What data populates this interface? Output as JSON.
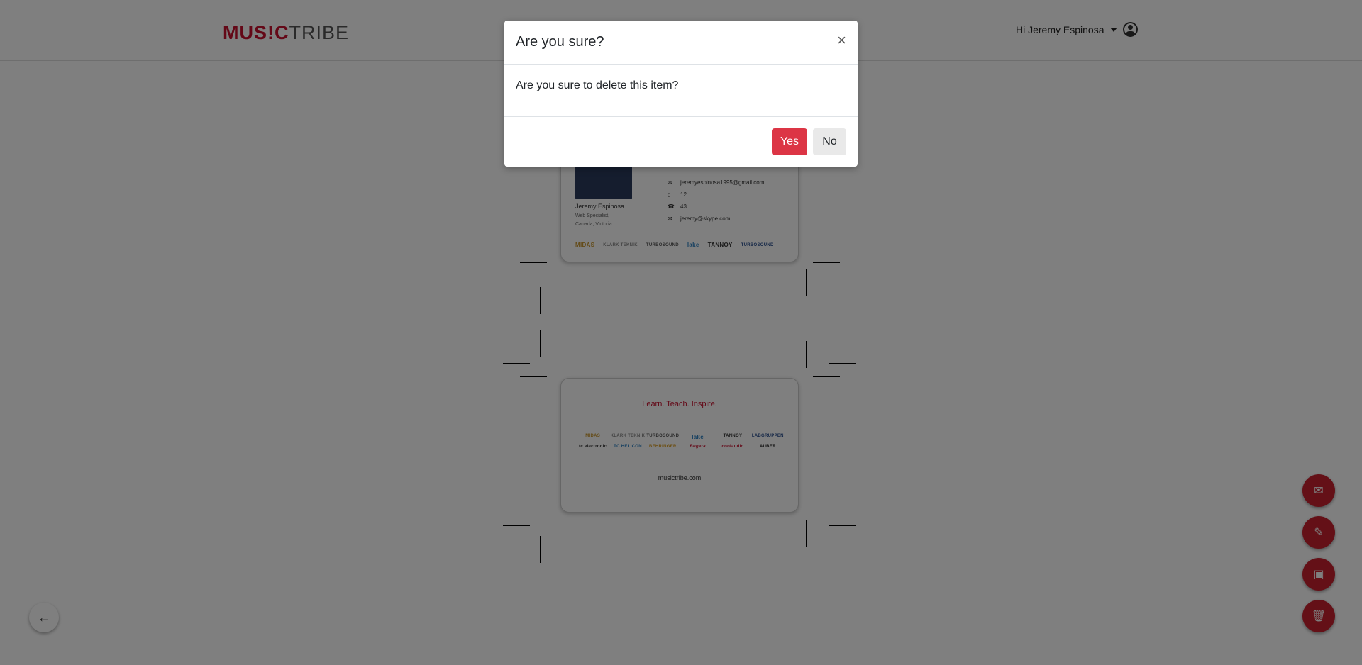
{
  "header": {
    "logo_music": "MUS!C",
    "logo_tribe": "TRIBE",
    "user_greeting": "Hi Jeremy Espinosa"
  },
  "card_front": {
    "name": "Jeremy Espinosa",
    "title": "Web Specialist,",
    "location": "Canada, Victoria",
    "contacts": [
      {
        "icon": "envelope-icon",
        "value": "jeremyespinosa1995@gmail.com"
      },
      {
        "icon": "mobile-icon",
        "value": "12"
      },
      {
        "icon": "phone-icon",
        "value": "43"
      },
      {
        "icon": "skype-icon",
        "value": "jeremy@skype.com"
      }
    ],
    "brands": [
      "MIDAS",
      "KLARK TEKNIK",
      "TURBOSOUND",
      "lake",
      "TANNOY",
      "TURBOSOUND"
    ]
  },
  "card_back": {
    "tagline": "Learn. Teach. Inspire.",
    "brands": [
      "MIDAS",
      "KLARK TEKNIK",
      "TURBOSOUND",
      "lake",
      "TANNOY",
      "LABGRUPPEN",
      "tc electronic",
      "TC HELICON",
      "BEHRINGER",
      "Bugera",
      "coolaudio",
      "AUBER"
    ],
    "website": "musictribe.com"
  },
  "colors": {
    "brand_red": "#c8102e",
    "danger": "#dc3545",
    "fab": "#c8202e"
  },
  "modal": {
    "title": "Are you sure?",
    "close": "×",
    "message": "Are you sure to delete this item?",
    "yes": "Yes",
    "no": "No"
  },
  "fabs": [
    {
      "icon": "envelope-icon"
    },
    {
      "icon": "edit-icon"
    },
    {
      "icon": "save-icon"
    },
    {
      "icon": "trash-icon"
    }
  ]
}
